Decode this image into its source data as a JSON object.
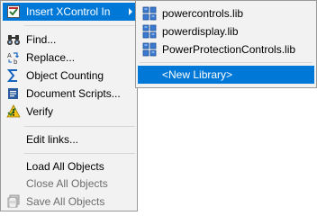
{
  "context_menu": {
    "insert_xcontrol": "Insert XControl In",
    "find": "Find...",
    "replace": "Replace...",
    "object_counting": "Object Counting",
    "document_scripts": "Document Scripts...",
    "verify": "Verify",
    "edit_links": "Edit links...",
    "load_all": "Load All Objects",
    "close_all": "Close All Objects",
    "save_all": "Save All Objects"
  },
  "submenu": {
    "items": [
      "powercontrols.lib",
      "powerdisplay.lib",
      "PowerProtectionControls.lib"
    ],
    "new_library": "<New Library>"
  },
  "colors": {
    "highlight": "#0078d7",
    "menu_bg": "#f2f2f2",
    "disabled_text": "#6d6d6d"
  },
  "icons": [
    "xcontrol-icon",
    "binoculars-icon",
    "replace-icon",
    "sigma-icon",
    "scripts-icon",
    "verify-warning-icon",
    "library-icon"
  ]
}
